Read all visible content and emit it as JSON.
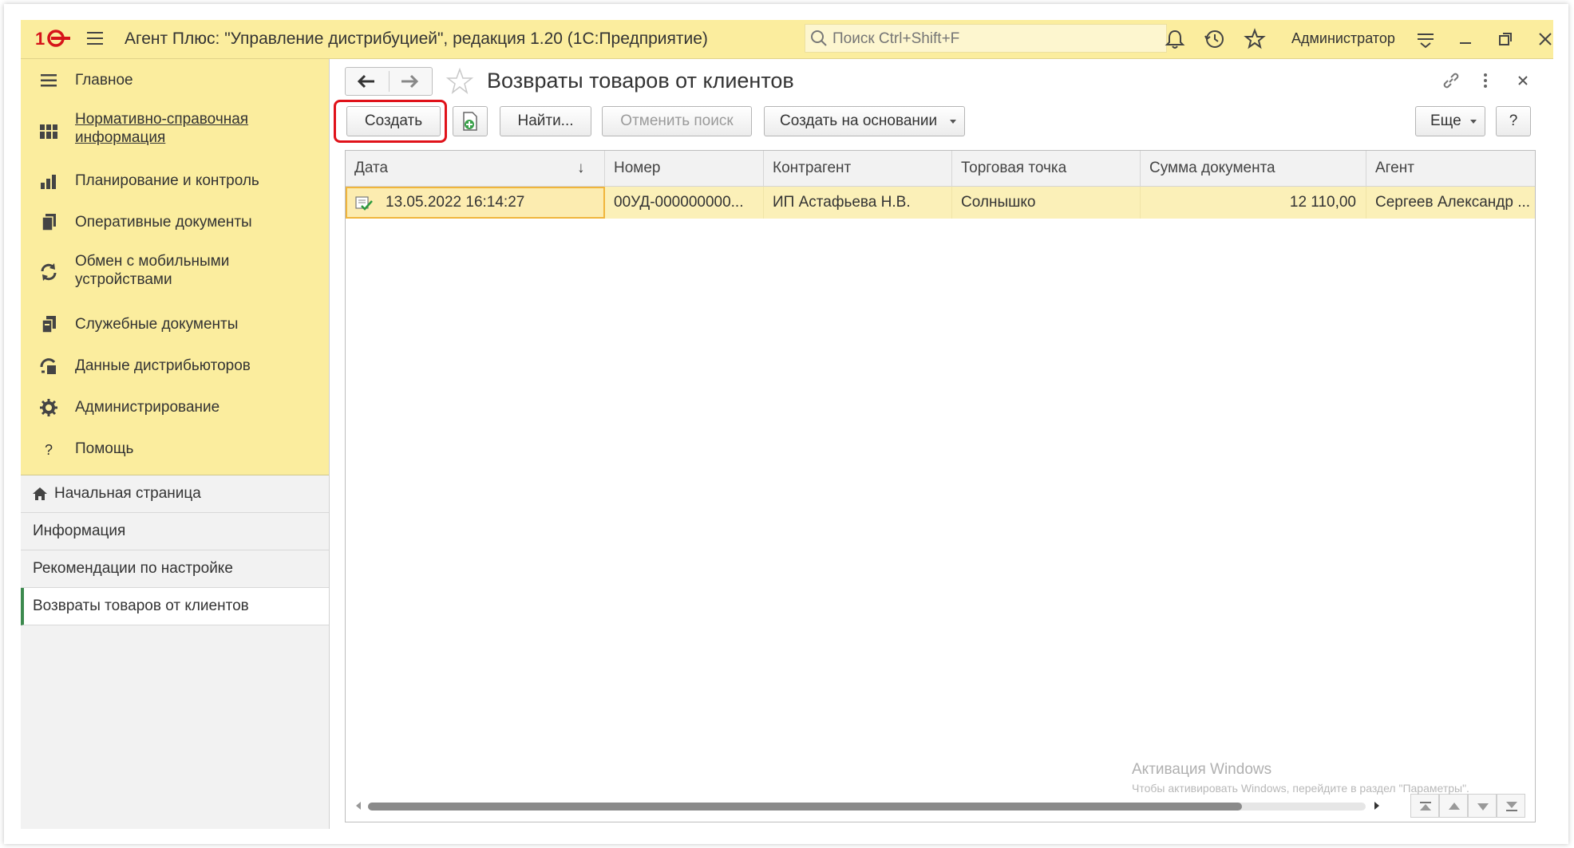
{
  "titlebar": {
    "title": "Агент Плюс: \"Управление дистрибуцией\", редакция 1.20  (1С:Предприятие)",
    "search_placeholder": "Поиск Ctrl+Shift+F",
    "user": "Администратор"
  },
  "sidebar": {
    "sections": [
      {
        "label": "Главное",
        "icon": "menu-lines-icon"
      },
      {
        "label": "Нормативно-справочная информация",
        "icon": "grid-icon"
      },
      {
        "label": "Планирование и контроль",
        "icon": "bar-chart-icon"
      },
      {
        "label": "Оперативные документы",
        "icon": "documents-icon"
      },
      {
        "label": "Обмен с мобильными устройствами",
        "icon": "sync-icon"
      },
      {
        "label": "Служебные документы",
        "icon": "service-docs-icon"
      },
      {
        "label": "Данные дистрибьюторов",
        "icon": "distributors-icon"
      },
      {
        "label": "Администрирование",
        "icon": "gear-icon"
      },
      {
        "label": "Помощь",
        "icon": "help-icon"
      }
    ],
    "open_windows": [
      {
        "label": "Начальная страница",
        "icon": "home-icon"
      },
      {
        "label": "Информация"
      },
      {
        "label": "Рекомендации по настройке"
      },
      {
        "label": "Возвраты товаров от клиентов"
      }
    ]
  },
  "form": {
    "title": "Возвраты товаров от клиентов",
    "buttons": {
      "create": "Создать",
      "find": "Найти...",
      "cancel_search": "Отменить поиск",
      "create_based_on": "Создать на основании",
      "more": "Еще",
      "help": "?"
    }
  },
  "table": {
    "columns": [
      "Дата",
      "Номер",
      "Контрагент",
      "Торговая точка",
      "Сумма документа",
      "Агент"
    ],
    "sort_indicator": "↓",
    "rows": [
      {
        "date": "13.05.2022 16:14:27",
        "number": "00УД-000000000...",
        "counterparty": "ИП Астафьева Н.В.",
        "outlet": "Солнышко",
        "amount": "12 110,00",
        "agent": "Сергеев Александр ..."
      }
    ]
  },
  "watermark": {
    "line1": "Активация Windows",
    "line2": "Чтобы активировать Windows, перейдите в раздел \"Параметры\"."
  },
  "colors": {
    "accent_yellow": "#fbed9e",
    "selected_row": "#fbf0b8",
    "highlight_red": "#e0121a",
    "active_green": "#3c8a4e"
  }
}
